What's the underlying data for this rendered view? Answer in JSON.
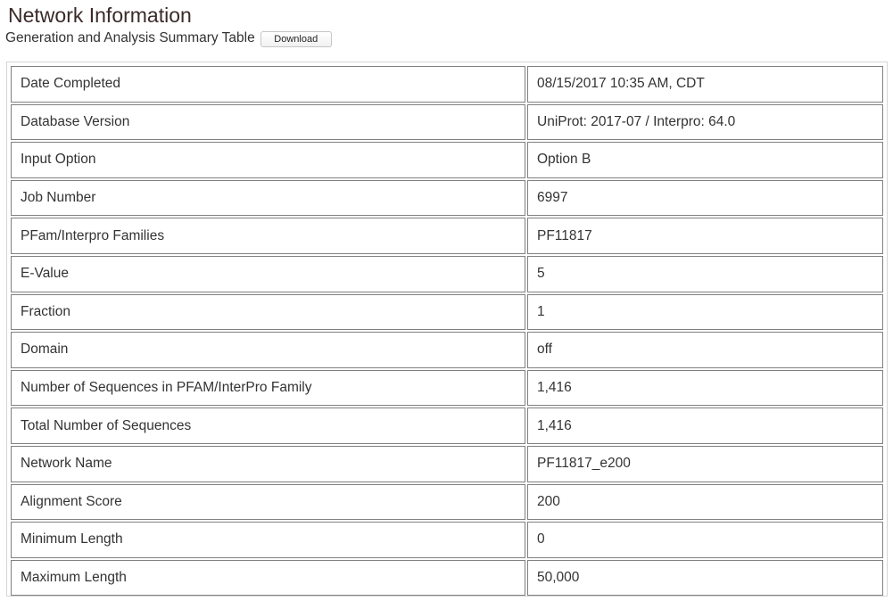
{
  "header": {
    "title": "Network Information",
    "subtitle": "Generation and Analysis Summary Table",
    "download_label": "Download"
  },
  "summary_table": {
    "rows": [
      {
        "label": "Date Completed",
        "value": "08/15/2017 10:35 AM, CDT"
      },
      {
        "label": "Database Version",
        "value": "UniProt: 2017-07 / Interpro: 64.0"
      },
      {
        "label": "Input Option",
        "value": "Option B"
      },
      {
        "label": "Job Number",
        "value": "6997"
      },
      {
        "label": "PFam/Interpro Families",
        "value": "PF11817"
      },
      {
        "label": "E-Value",
        "value": "5"
      },
      {
        "label": "Fraction",
        "value": "1"
      },
      {
        "label": "Domain",
        "value": "off"
      },
      {
        "label": "Number of Sequences in PFAM/InterPro Family",
        "value": "1,416"
      },
      {
        "label": "Total Number of Sequences",
        "value": "1,416"
      },
      {
        "label": "Network Name",
        "value": "PF11817_e200"
      },
      {
        "label": "Alignment Score",
        "value": "200"
      },
      {
        "label": "Minimum Length",
        "value": "0"
      },
      {
        "label": "Maximum Length",
        "value": "50,000"
      }
    ]
  }
}
